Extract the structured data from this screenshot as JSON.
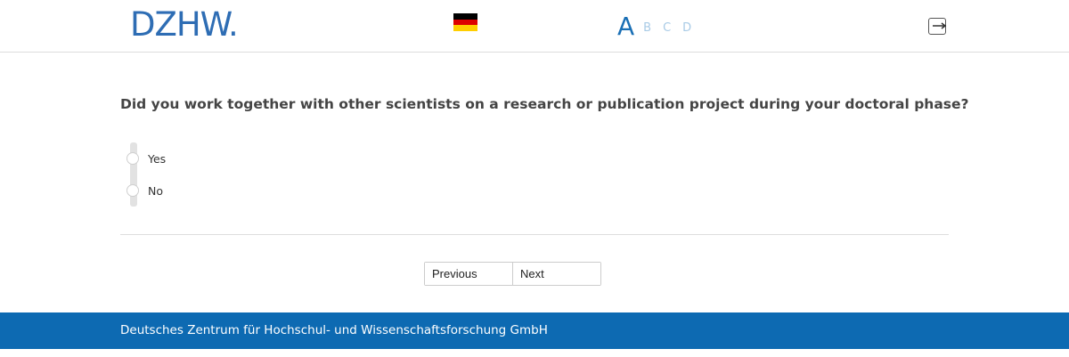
{
  "header": {
    "logo_text": "DZHW",
    "logo_dot": ".",
    "language_flag": "flag-germany",
    "steps": {
      "active": "A",
      "others": [
        "B",
        "C",
        "D"
      ]
    },
    "logout_icon": "logout-icon"
  },
  "question": {
    "text": "Did you work together with other scientists on a research or publication project during your doctoral phase?",
    "options": [
      {
        "label": "Yes",
        "selected": false
      },
      {
        "label": "No",
        "selected": false
      }
    ]
  },
  "navigation": {
    "previous_label": "Previous",
    "next_label": "Next"
  },
  "footer": {
    "text": "Deutsches Zentrum für Hochschul- und Wissenschaftsforschung GmbH"
  },
  "colors": {
    "brand_blue": "#0d6ab2",
    "logo_blue": "#2e6db4",
    "step_active": "#1a6fb5",
    "step_inactive": "#a9cbe6"
  }
}
